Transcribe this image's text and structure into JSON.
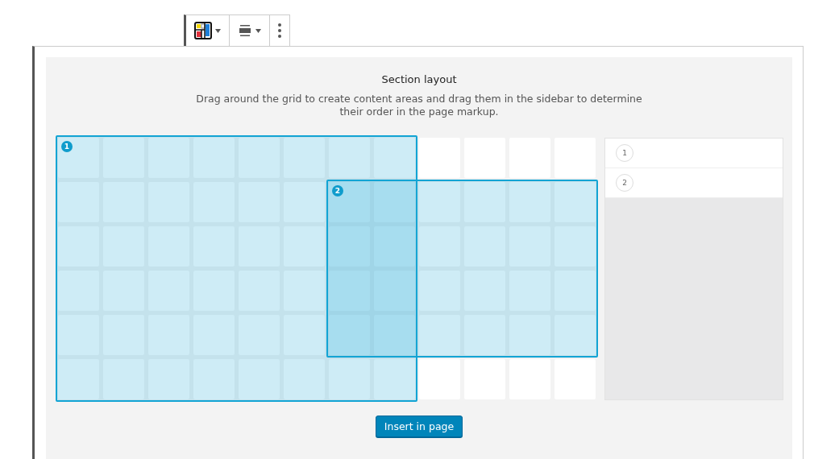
{
  "toolbar": {
    "buttons": [
      {
        "kind": "layout",
        "caret": true
      },
      {
        "kind": "align",
        "caret": true
      },
      {
        "kind": "more",
        "caret": false
      }
    ]
  },
  "section": {
    "title": "Section layout",
    "description": "Drag around the grid to create content areas and drag them in the sidebar to determine their order in the page markup.",
    "areas": [
      {
        "label": "1"
      },
      {
        "label": "2"
      }
    ],
    "order": [
      {
        "label": "1"
      },
      {
        "label": "2"
      }
    ],
    "insert_button": "Insert in page"
  }
}
